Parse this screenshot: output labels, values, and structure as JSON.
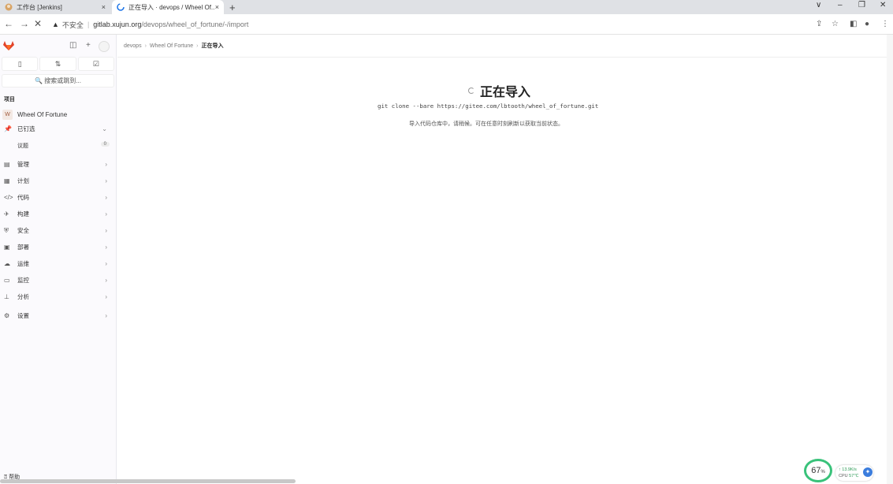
{
  "browser": {
    "tabs": [
      {
        "title": "工作台 [Jenkins]",
        "close": "×"
      },
      {
        "title": "正在导入 · devops / Wheel Of...",
        "close": "×"
      }
    ],
    "new_tab": "+",
    "window_controls": [
      "∨",
      "–",
      "❐",
      "✕"
    ],
    "back": "←",
    "forward": "→",
    "reload": "✕",
    "security_warning": "不安全",
    "url_host": "gitlab.xujun.org",
    "url_path": "/devops/wheel_of_fortune/-/import"
  },
  "sidebar": {
    "quick_icons": [
      "▯",
      "⇅",
      "☑"
    ],
    "search_placeholder": "🔍 搜索或跳到...",
    "section_label": "项目",
    "project": {
      "avatar": "W",
      "name": "Wheel Of Fortune"
    },
    "pinned": {
      "label": "已钉选",
      "sub": {
        "label": "议题",
        "count": "0"
      }
    },
    "items": [
      {
        "icon": "▤",
        "label": "管理"
      },
      {
        "icon": "▦",
        "label": "计划"
      },
      {
        "icon": "</>",
        "label": "代码"
      },
      {
        "icon": "✈",
        "label": "构建"
      },
      {
        "icon": "⛨",
        "label": "安全"
      },
      {
        "icon": "▣",
        "label": "部署"
      },
      {
        "icon": "☁",
        "label": "运维"
      },
      {
        "icon": "▭",
        "label": "监控"
      },
      {
        "icon": "⊥",
        "label": "分析"
      },
      {
        "icon": "⚙",
        "label": "设置"
      }
    ],
    "help": "帮助"
  },
  "breadcrumb": [
    "devops",
    "Wheel Of Fortune",
    "正在导入"
  ],
  "main": {
    "title": "正在导入",
    "command": "git clone --bare https://gitee.com/lbtooth/wheel_of_fortune.git",
    "info": "导入代码仓库中，请稍候。可在任意时刻刷新以获取当前状态。"
  },
  "widget": {
    "percent": "67",
    "percent_unit": "%",
    "net_speed": "↑ 13.9K/s",
    "cpu_label": "CPU",
    "cpu_temp": "57℃"
  },
  "colors": {
    "accent": "#e24329",
    "gauge": "#39c27a"
  }
}
